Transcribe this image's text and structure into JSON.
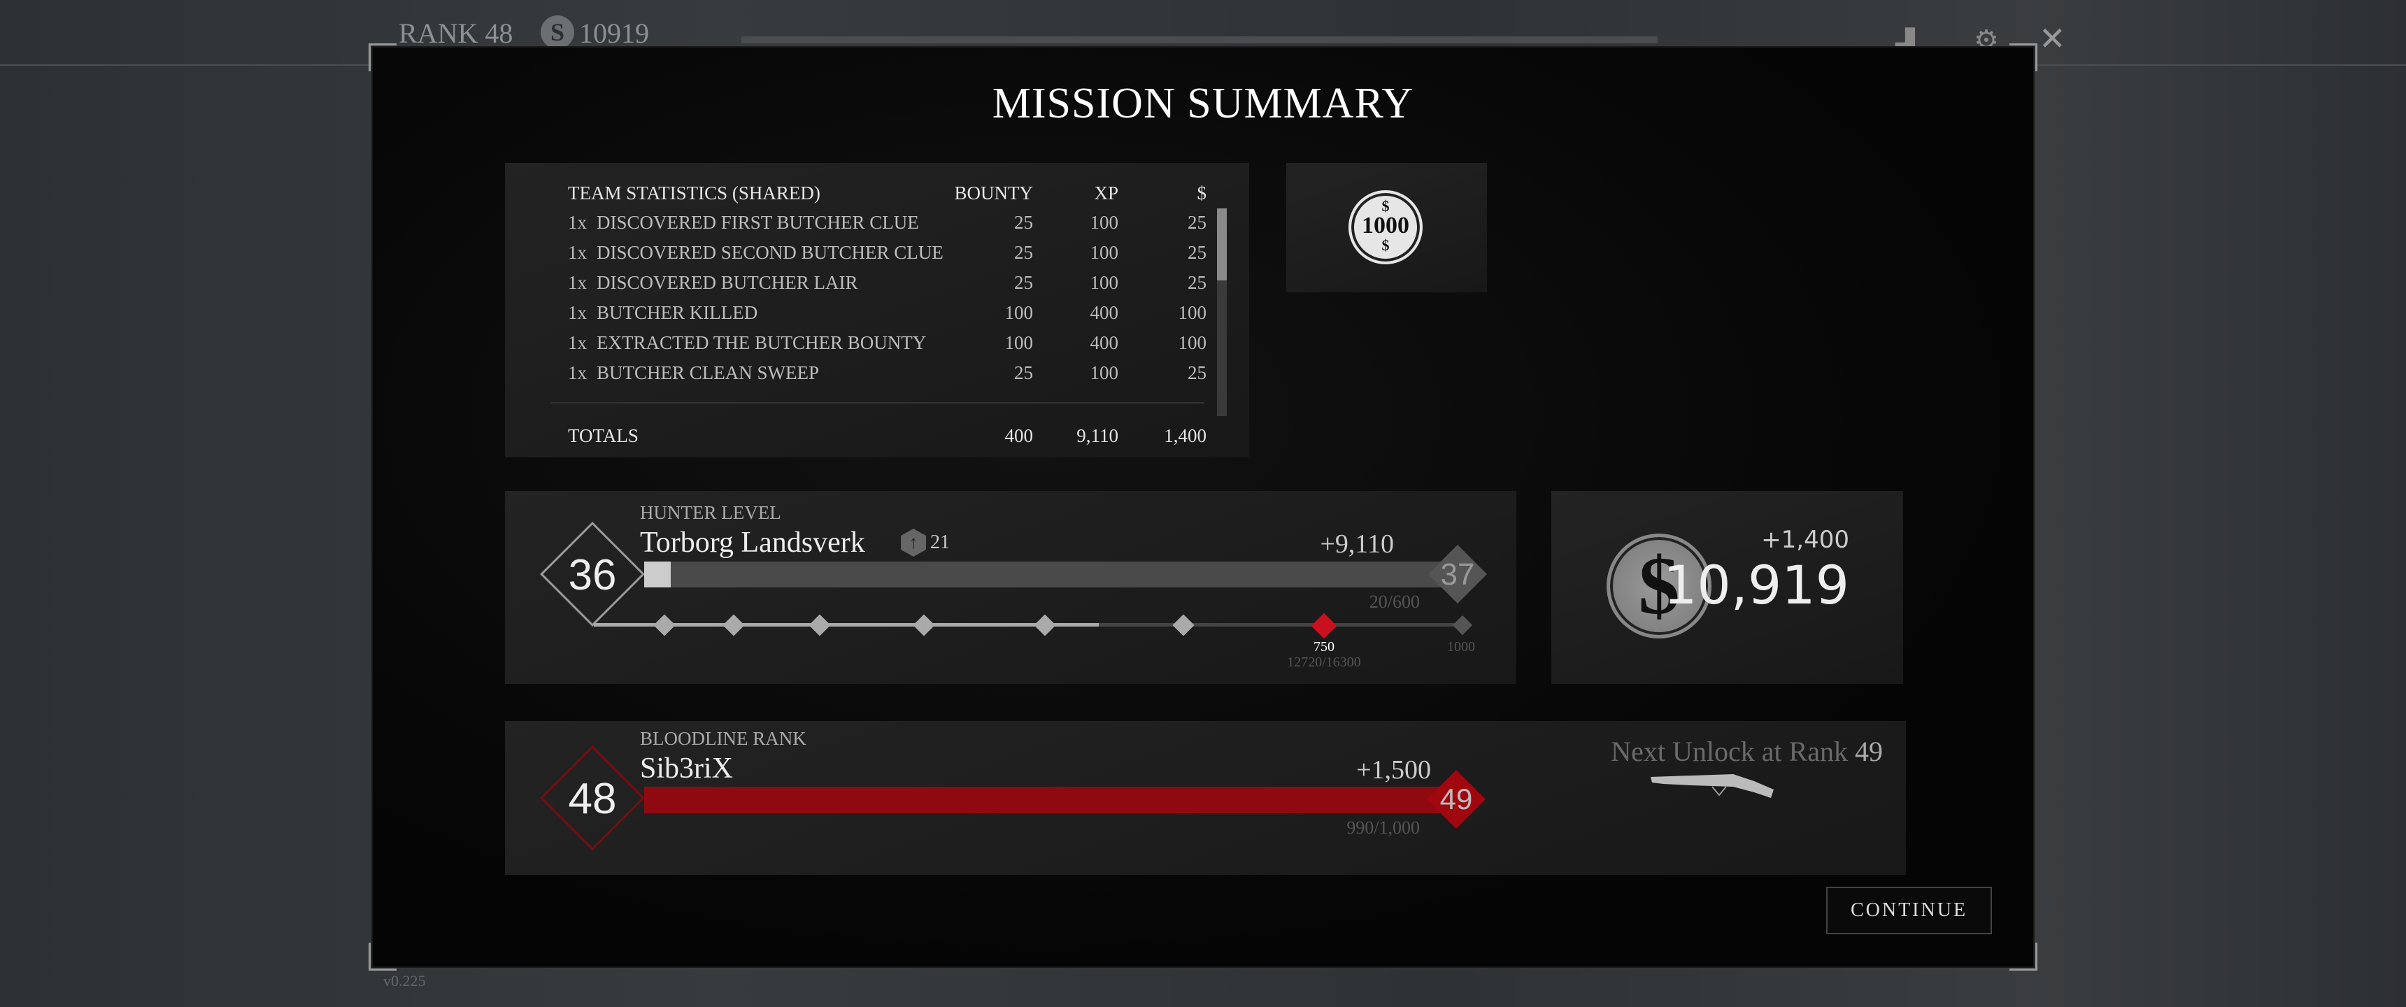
{
  "topbar": {
    "rank": "RANK 48",
    "currency": "10919",
    "icons": [
      "leaderboard-icon",
      "settings-gear-icon",
      "close-icon"
    ]
  },
  "modal": {
    "title": "MISSION SUMMARY"
  },
  "stats": {
    "header": {
      "label": "TEAM STATISTICS (SHARED)",
      "bounty": "BOUNTY",
      "xp": "XP",
      "dollars": "$"
    },
    "rows": [
      {
        "qty": "1x",
        "label": "DISCOVERED FIRST BUTCHER CLUE",
        "bounty": "25",
        "xp": "100",
        "dollars": "25"
      },
      {
        "qty": "1x",
        "label": "DISCOVERED SECOND BUTCHER CLUE",
        "bounty": "25",
        "xp": "100",
        "dollars": "25"
      },
      {
        "qty": "1x",
        "label": "DISCOVERED BUTCHER LAIR",
        "bounty": "25",
        "xp": "100",
        "dollars": "25"
      },
      {
        "qty": "1x",
        "label": "BUTCHER KILLED",
        "bounty": "100",
        "xp": "400",
        "dollars": "100"
      },
      {
        "qty": "1x",
        "label": "EXTRACTED THE BUTCHER BOUNTY",
        "bounty": "100",
        "xp": "400",
        "dollars": "100"
      },
      {
        "qty": "1x",
        "label": "BUTCHER CLEAN SWEEP",
        "bounty": "25",
        "xp": "100",
        "dollars": "25"
      }
    ],
    "totals": {
      "label": "TOTALS",
      "bounty": "400",
      "xp": "9,110",
      "dollars": "1,400"
    }
  },
  "bonus_coin": {
    "value": "1000",
    "symbol": "$"
  },
  "hunter": {
    "section_label": "HUNTER LEVEL",
    "name": "Torborg Landsverk",
    "upgrade_points": "21",
    "level": "36",
    "next_level": "37",
    "xp_gain": "+9,110",
    "progress": "20/600",
    "progress_fraction": 0.033,
    "milestone": {
      "value": "750",
      "progress": "12720/16300",
      "max": "1000"
    },
    "accent": "#c8101e"
  },
  "money": {
    "gain": "+1,400",
    "total": "10,919",
    "symbol": "$"
  },
  "bloodline": {
    "section_label": "BLOODLINE RANK",
    "name": "Sib3riX",
    "rank": "48",
    "next_rank": "49",
    "gain": "+1,500",
    "progress": "990/1,000",
    "progress_fraction": 0.99,
    "bar_color": "#8e0a10",
    "next_unlock_prefix": "Next Unlock at Rank",
    "next_unlock_rank": "49"
  },
  "continue_label": "CONTINUE",
  "version": "v0.225"
}
